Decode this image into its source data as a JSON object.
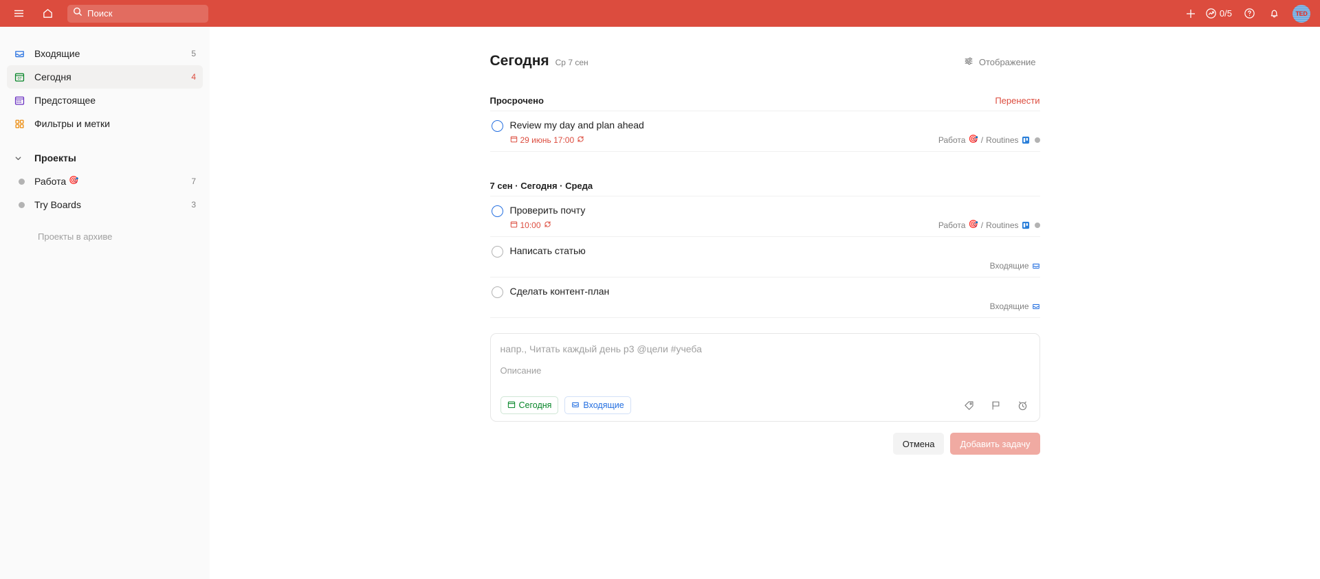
{
  "topbar": {
    "menu_icon": "hamburger-menu-icon",
    "home_icon": "home-icon",
    "search": {
      "placeholder": "Поиск",
      "icon": "search-icon",
      "value": ""
    },
    "add_icon": "plus-icon",
    "productivity": {
      "icon": "productivity-chart-icon",
      "count": "0/5"
    },
    "help_icon": "help-question-icon",
    "notifications_icon": "bell-icon",
    "avatar": {
      "name": "avatar",
      "initials": "TED"
    },
    "background_color": "#dc4c3e"
  },
  "sidebar": {
    "items": [
      {
        "label": "Входящие",
        "count": "5",
        "icon": "inbox-icon",
        "selected": false
      },
      {
        "label": "Сегодня",
        "count": "4",
        "icon": "calendar-today-icon",
        "selected": true,
        "day_number": "07"
      },
      {
        "label": "Предстоящее",
        "count": "",
        "icon": "calendar-upcoming-icon",
        "selected": false
      },
      {
        "label": "Фильтры и метки",
        "count": "",
        "icon": "filters-labels-icon",
        "selected": false
      }
    ],
    "projects_section": {
      "label": "Проекты",
      "chevron_icon": "chevron-down-icon",
      "items": [
        {
          "label": "Работа",
          "emoji": "🎯",
          "count": "7",
          "dot_color": "#b3b3b3"
        },
        {
          "label": "Try Boards",
          "emoji": "",
          "count": "3",
          "dot_color": "#b3b3b3"
        }
      ]
    },
    "archive_note": "Проекты в архиве"
  },
  "main": {
    "title": "Сегодня",
    "subtitle": "Ср 7 сен",
    "view_button": {
      "label": "Отображение",
      "icon": "sliders-icon"
    },
    "groups": [
      {
        "title": "Просрочено",
        "action_label": "Перенести",
        "tasks": [
          {
            "title": "Review my day and plan ahead",
            "checkbox_style": "priority-blue",
            "due": "29 июнь 17:00",
            "due_icon": "calendar-small-icon",
            "recurring_icon": "recurring-icon",
            "project": "Работа",
            "project_emoji": "🎯",
            "separator": "/",
            "section": "Routines",
            "board_icon": "board-icon",
            "has_right_dot": true
          }
        ]
      },
      {
        "title": "7 сен · Сегодня · Среда",
        "action_label": "",
        "tasks": [
          {
            "title": "Проверить почту",
            "checkbox_style": "priority-blue",
            "due": "10:00",
            "due_icon": "calendar-small-icon",
            "recurring_icon": "recurring-icon",
            "project": "Работа",
            "project_emoji": "🎯",
            "separator": "/",
            "section": "Routines",
            "board_icon": "board-icon",
            "has_right_dot": true
          },
          {
            "title": "Написать статью",
            "checkbox_style": "default",
            "due": "",
            "project": "Входящие",
            "project_emoji": "",
            "separator": "",
            "section": "",
            "inbox_icon": "inbox-icon",
            "has_right_dot": false
          },
          {
            "title": "Сделать контент-план",
            "checkbox_style": "default",
            "due": "",
            "project": "Входящие",
            "project_emoji": "",
            "separator": "",
            "section": "",
            "inbox_icon": "inbox-icon",
            "has_right_dot": false
          }
        ]
      }
    ],
    "composer": {
      "title_placeholder": "напр., Читать каждый день р3 @цели #учеба",
      "description_placeholder": "Описание",
      "date_chip": {
        "label": "Сегодня",
        "icon": "calendar-small-icon",
        "color": "#058527"
      },
      "project_chip": {
        "label": "Входящие",
        "icon": "inbox-icon",
        "color": "#246fe0"
      },
      "actions": [
        {
          "name": "label-icon",
          "title": "Метки"
        },
        {
          "name": "flag-priority-icon",
          "title": "Приоритет"
        },
        {
          "name": "alarm-reminder-icon",
          "title": "Напоминания"
        }
      ],
      "cancel_label": "Отмена",
      "submit_label": "Добавить задачу"
    }
  }
}
